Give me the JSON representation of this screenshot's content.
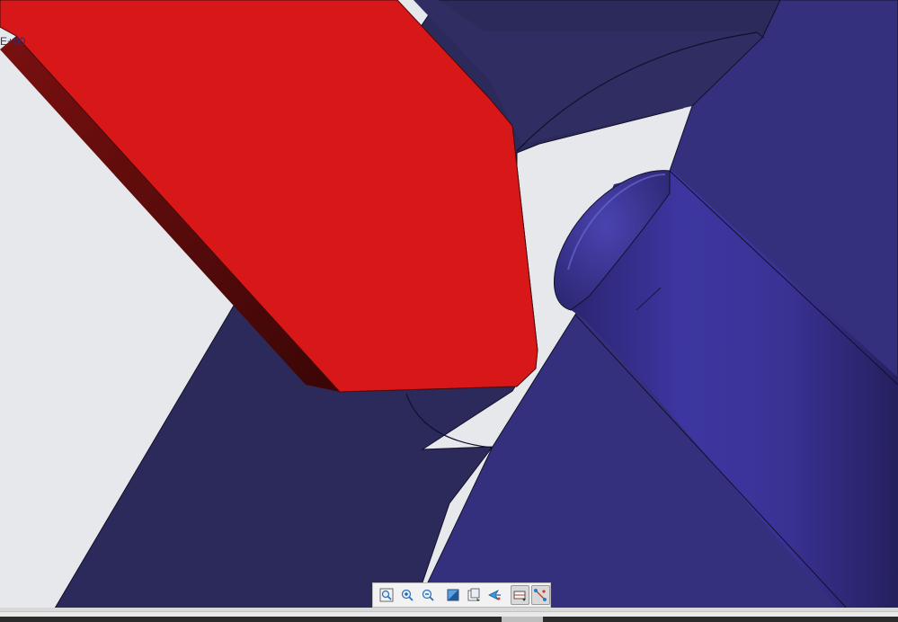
{
  "viewport": {
    "scale_label": "E+00"
  },
  "colors": {
    "background": "#e6e8ec",
    "red_part": "#d81818",
    "red_part_shadow": "#5a0c0c",
    "navy_plate": "#2c2a5a",
    "blue_plate": "#35307e",
    "cylinder": "#3a3390",
    "edge_line": "#12102a"
  },
  "toolbar": {
    "buttons": [
      {
        "name": "zoom-fit-icon",
        "pressed": false
      },
      {
        "name": "zoom-in-icon",
        "pressed": false
      },
      {
        "name": "zoom-out-icon",
        "pressed": false
      },
      {
        "name": "shade-mode-icon",
        "pressed": false
      },
      {
        "name": "saved-views-icon",
        "pressed": false
      },
      {
        "name": "spin-center-icon",
        "pressed": false
      },
      {
        "name": "datum-display-icon",
        "pressed": true
      },
      {
        "name": "axis-display-icon",
        "pressed": true
      }
    ]
  }
}
